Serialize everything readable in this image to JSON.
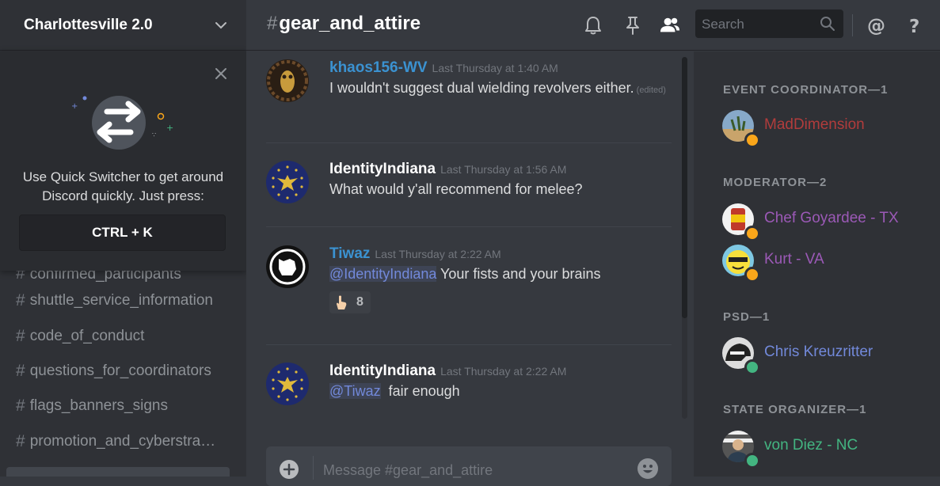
{
  "colors": {
    "author_khaos": "#3b92d1",
    "author_identity": "#ffffff",
    "author_tiwaz": "#3b92d1",
    "maddimension": "#b13c3c",
    "moderator": "#9b59b6",
    "psd": "#7289da",
    "state_organizer": "#43b581",
    "status_idle": "#faa61a",
    "status_online": "#43b581"
  },
  "server": {
    "name": "Charlottesville 2.0"
  },
  "quick_switcher": {
    "text_line1": "Use Quick Switcher to get around",
    "text_line2": "Discord quickly. Just press:",
    "shortcut": "CTRL + K"
  },
  "channels": [
    {
      "hash": "#",
      "name": "confirmed_participants"
    },
    {
      "hash": "#",
      "name": "shuttle_service_information"
    },
    {
      "hash": "#",
      "name": "code_of_conduct"
    },
    {
      "hash": "#",
      "name": "questions_for_coordinators"
    },
    {
      "hash": "#",
      "name": "flags_banners_signs"
    },
    {
      "hash": "#",
      "name": "promotion_and_cyberstrategy"
    }
  ],
  "channel_header": {
    "hash": "#",
    "name": "gear_and_attire"
  },
  "header_icons": [
    "bell-icon",
    "pin-icon",
    "members-icon",
    "mention-icon",
    "help-icon"
  ],
  "search": {
    "placeholder": "Search",
    "value": ""
  },
  "messages": [
    {
      "author": "khaos156-WV",
      "timestamp": "Last Thursday at 1:40 AM",
      "text": "I wouldn't suggest dual wielding revolvers either.",
      "edited": "(edited)"
    },
    {
      "author": "IdentityIndiana",
      "timestamp": "Last Thursday at 1:56 AM",
      "text": "What would y'all recommend for melee?"
    },
    {
      "author": "Tiwaz",
      "timestamp": "Last Thursday at 2:22 AM",
      "mention": "@IdentityIndiana",
      "text": " Your fists and your brains",
      "reaction": {
        "emoji": "point-up-hand-icon",
        "count": "8"
      }
    },
    {
      "author": "IdentityIndiana",
      "timestamp": "Last Thursday at 2:22 AM",
      "mention": "@Tiwaz",
      "text": "  fair enough"
    }
  ],
  "composer": {
    "placeholder": "Message #gear_and_attire"
  },
  "member_list": {
    "roles": [
      {
        "title": "EVENT COORDINATOR—1",
        "members": [
          {
            "name": "MadDimension",
            "status": "idle"
          }
        ]
      },
      {
        "title": "MODERATOR—2",
        "members": [
          {
            "name": "Chef Goyardee - TX",
            "status": "idle"
          },
          {
            "name": "Kurt - VA",
            "status": "idle"
          }
        ]
      },
      {
        "title": "PSD—1",
        "members": [
          {
            "name": "Chris Kreuzritter",
            "status": "online"
          }
        ]
      },
      {
        "title": "STATE ORGANIZER—1",
        "members": [
          {
            "name": "von Diez - NC",
            "status": "online"
          }
        ]
      }
    ]
  }
}
